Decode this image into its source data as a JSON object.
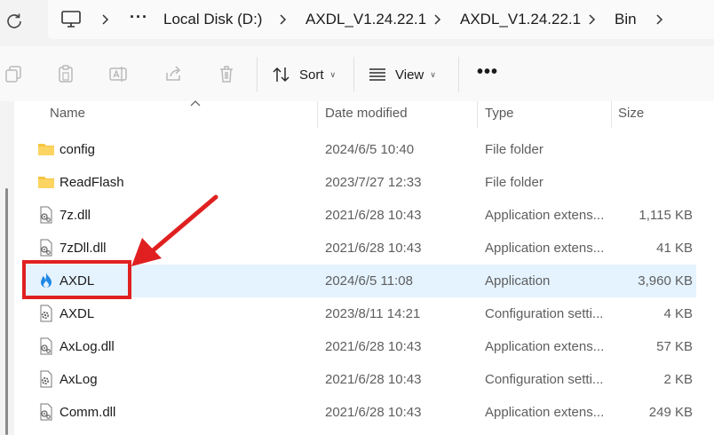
{
  "address_bar": {
    "overflow": "···",
    "crumbs": [
      "Local Disk (D:)",
      "AXDL_V1.24.22.1",
      "AXDL_V1.24.22.1",
      "Bin"
    ]
  },
  "command_bar": {
    "sort_label": "Sort",
    "view_label": "View",
    "more_label": "•••"
  },
  "columns": {
    "name": "Name",
    "date": "Date modified",
    "type": "Type",
    "size": "Size"
  },
  "files": [
    {
      "name": "config",
      "date": "2024/6/5 10:40",
      "type": "File folder",
      "size": "",
      "icon": "folder-icon"
    },
    {
      "name": "ReadFlash",
      "date": "2023/7/27 12:33",
      "type": "File folder",
      "size": "",
      "icon": "folder-icon"
    },
    {
      "name": "7z.dll",
      "date": "2021/6/28 10:43",
      "type": "Application extens...",
      "size": "1,115 KB",
      "icon": "dll-file-icon"
    },
    {
      "name": "7zDll.dll",
      "date": "2021/6/28 10:43",
      "type": "Application extens...",
      "size": "41 KB",
      "icon": "dll-file-icon"
    },
    {
      "name": "AXDL",
      "date": "2024/6/5 11:08",
      "type": "Application",
      "size": "3,960 KB",
      "icon": "flame-app-icon"
    },
    {
      "name": "AXDL",
      "date": "2023/8/11 14:21",
      "type": "Configuration setti...",
      "size": "4 KB",
      "icon": "config-file-icon"
    },
    {
      "name": "AxLog.dll",
      "date": "2021/6/28 10:43",
      "type": "Application extens...",
      "size": "57 KB",
      "icon": "dll-file-icon"
    },
    {
      "name": "AxLog",
      "date": "2021/6/28 10:43",
      "type": "Configuration setti...",
      "size": "2 KB",
      "icon": "config-file-icon"
    },
    {
      "name": "Comm.dll",
      "date": "2021/6/28 10:43",
      "type": "Application extens...",
      "size": "249 KB",
      "icon": "dll-file-icon"
    }
  ],
  "colors": {
    "selected_row": "#e5f3ff",
    "annotation_red": "#e02020",
    "folder_yellow": "#f8c541",
    "flame_blue": "#1e88e5"
  }
}
